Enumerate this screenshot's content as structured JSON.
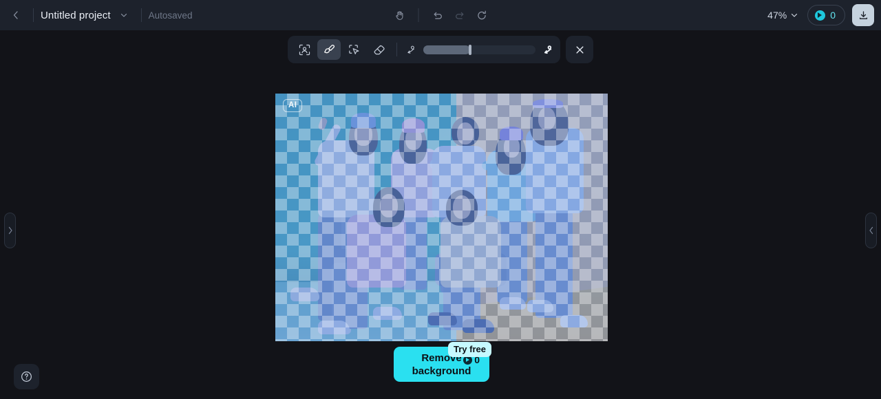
{
  "header": {
    "back_icon": "chevron-left-icon",
    "project_title": "Untitled project",
    "title_dropdown_icon": "chevron-down-icon",
    "save_status": "Autosaved",
    "center_tools": [
      {
        "name": "hand-tool",
        "icon": "hand-icon",
        "state": "enabled"
      },
      {
        "name": "undo",
        "icon": "undo-arrow-icon",
        "state": "enabled"
      },
      {
        "name": "redo",
        "icon": "redo-arrow-icon",
        "state": "disabled"
      },
      {
        "name": "reset",
        "icon": "refresh-icon",
        "state": "enabled"
      }
    ],
    "zoom_level": "47%",
    "zoom_dropdown_icon": "chevron-down-icon",
    "credits_count": "0",
    "credits_icon": "credit-coin-icon",
    "download_icon": "download-icon",
    "bg_color": "#1d222c"
  },
  "toolbar": {
    "tools": [
      {
        "name": "auto-select-subject",
        "icon": "person-frame-icon",
        "active": false
      },
      {
        "name": "brush-tool",
        "icon": "paintbrush-icon",
        "active": true
      },
      {
        "name": "magic-select-tool",
        "icon": "marquee-cursor-icon",
        "active": false
      },
      {
        "name": "eraser-tool",
        "icon": "eraser-icon",
        "active": false
      }
    ],
    "brush_size": {
      "name": "brush-size-slider",
      "small_icon": "small-stroke-icon",
      "large_icon": "large-stroke-icon",
      "value_percent": 42
    },
    "close_icon": "close-x-icon"
  },
  "canvas": {
    "bg_color": "#121318",
    "image": {
      "ai_badge_label": "AI",
      "alt": "Group photo of seven young people posing against a teal and orange backdrop",
      "selection_overlay_color": "#5682d6",
      "selection_active": true
    },
    "left_panel_handle_icon": "chevron-right-icon",
    "right_panel_handle_icon": "chevron-left-icon"
  },
  "cta": {
    "label_line1": "Remove",
    "label_line2": "background",
    "cost": "0",
    "cost_icon": "credit-coin-icon",
    "badge_label": "Try free",
    "accent_color": "#2ae0f0",
    "badge_color": "#c6f9ff"
  },
  "help": {
    "name": "help-button",
    "icon": "question-circle-icon"
  }
}
